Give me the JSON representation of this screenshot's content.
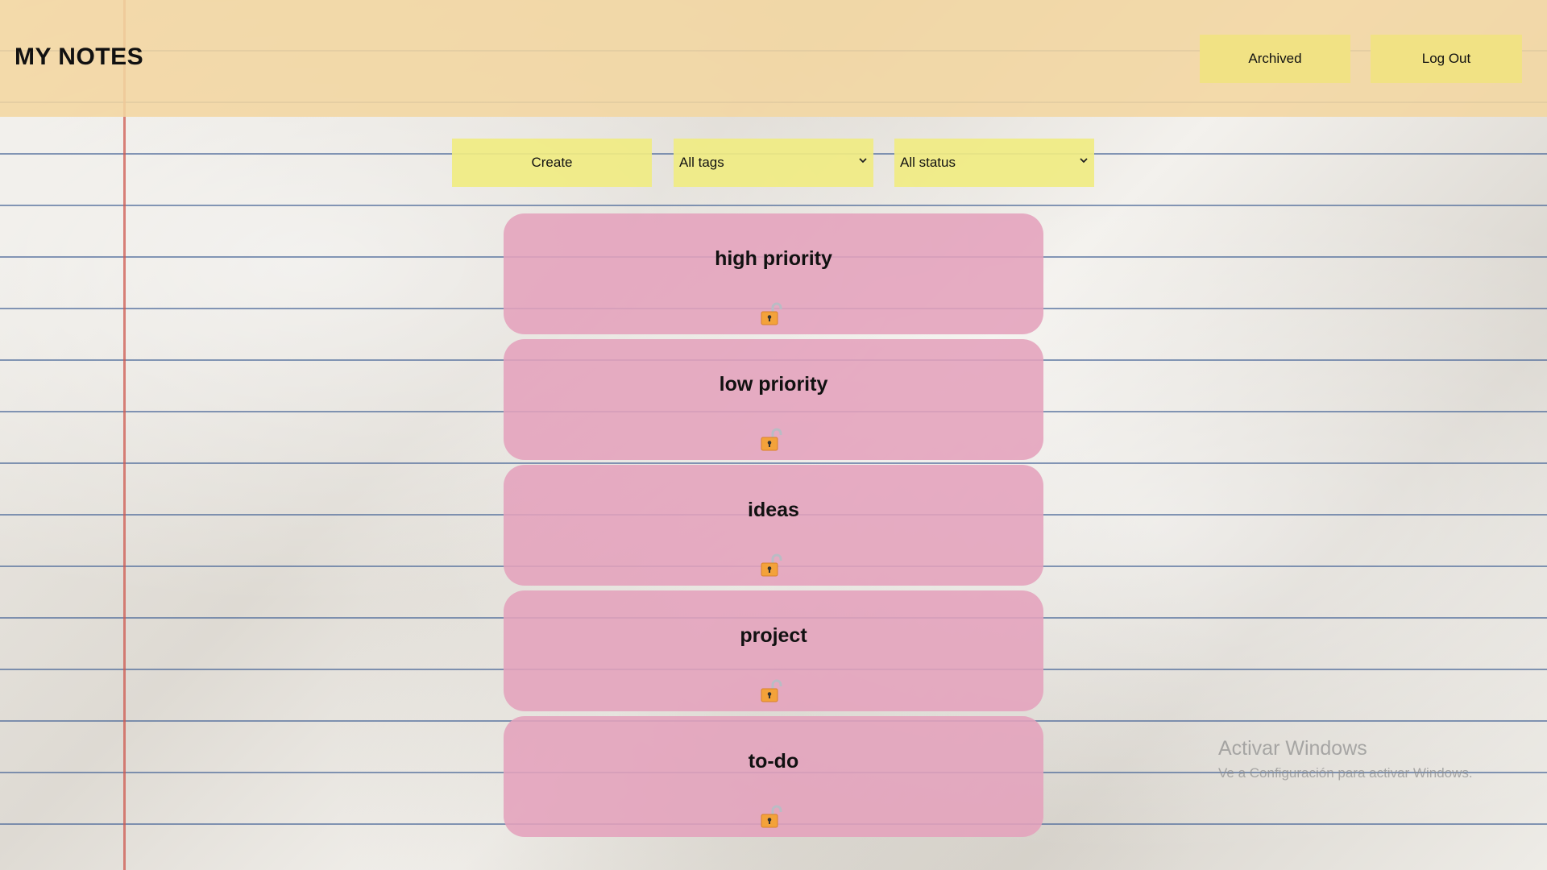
{
  "header": {
    "title": "MY NOTES",
    "archived_label": "Archived",
    "logout_label": "Log Out"
  },
  "toolbar": {
    "create_label": "Create",
    "tags_selected": "All tags",
    "status_selected": "All status"
  },
  "notes": [
    {
      "title": "high priority",
      "icon": "unlocked-padlock-icon"
    },
    {
      "title": "low priority",
      "icon": "unlocked-padlock-icon"
    },
    {
      "title": "ideas",
      "icon": "unlocked-padlock-icon"
    },
    {
      "title": "project",
      "icon": "unlocked-padlock-icon"
    },
    {
      "title": "to-do",
      "icon": "unlocked-padlock-icon"
    }
  ],
  "watermark": {
    "title": "Activar Windows",
    "subtitle": "Ve a Configuración para activar Windows."
  },
  "colors": {
    "header": "#f3d6a0",
    "button_yellow": "#f1e284",
    "note_pink": "#e4a2bc",
    "margin_red": "#cd5a50",
    "ruled_blue": "#4664a0"
  }
}
